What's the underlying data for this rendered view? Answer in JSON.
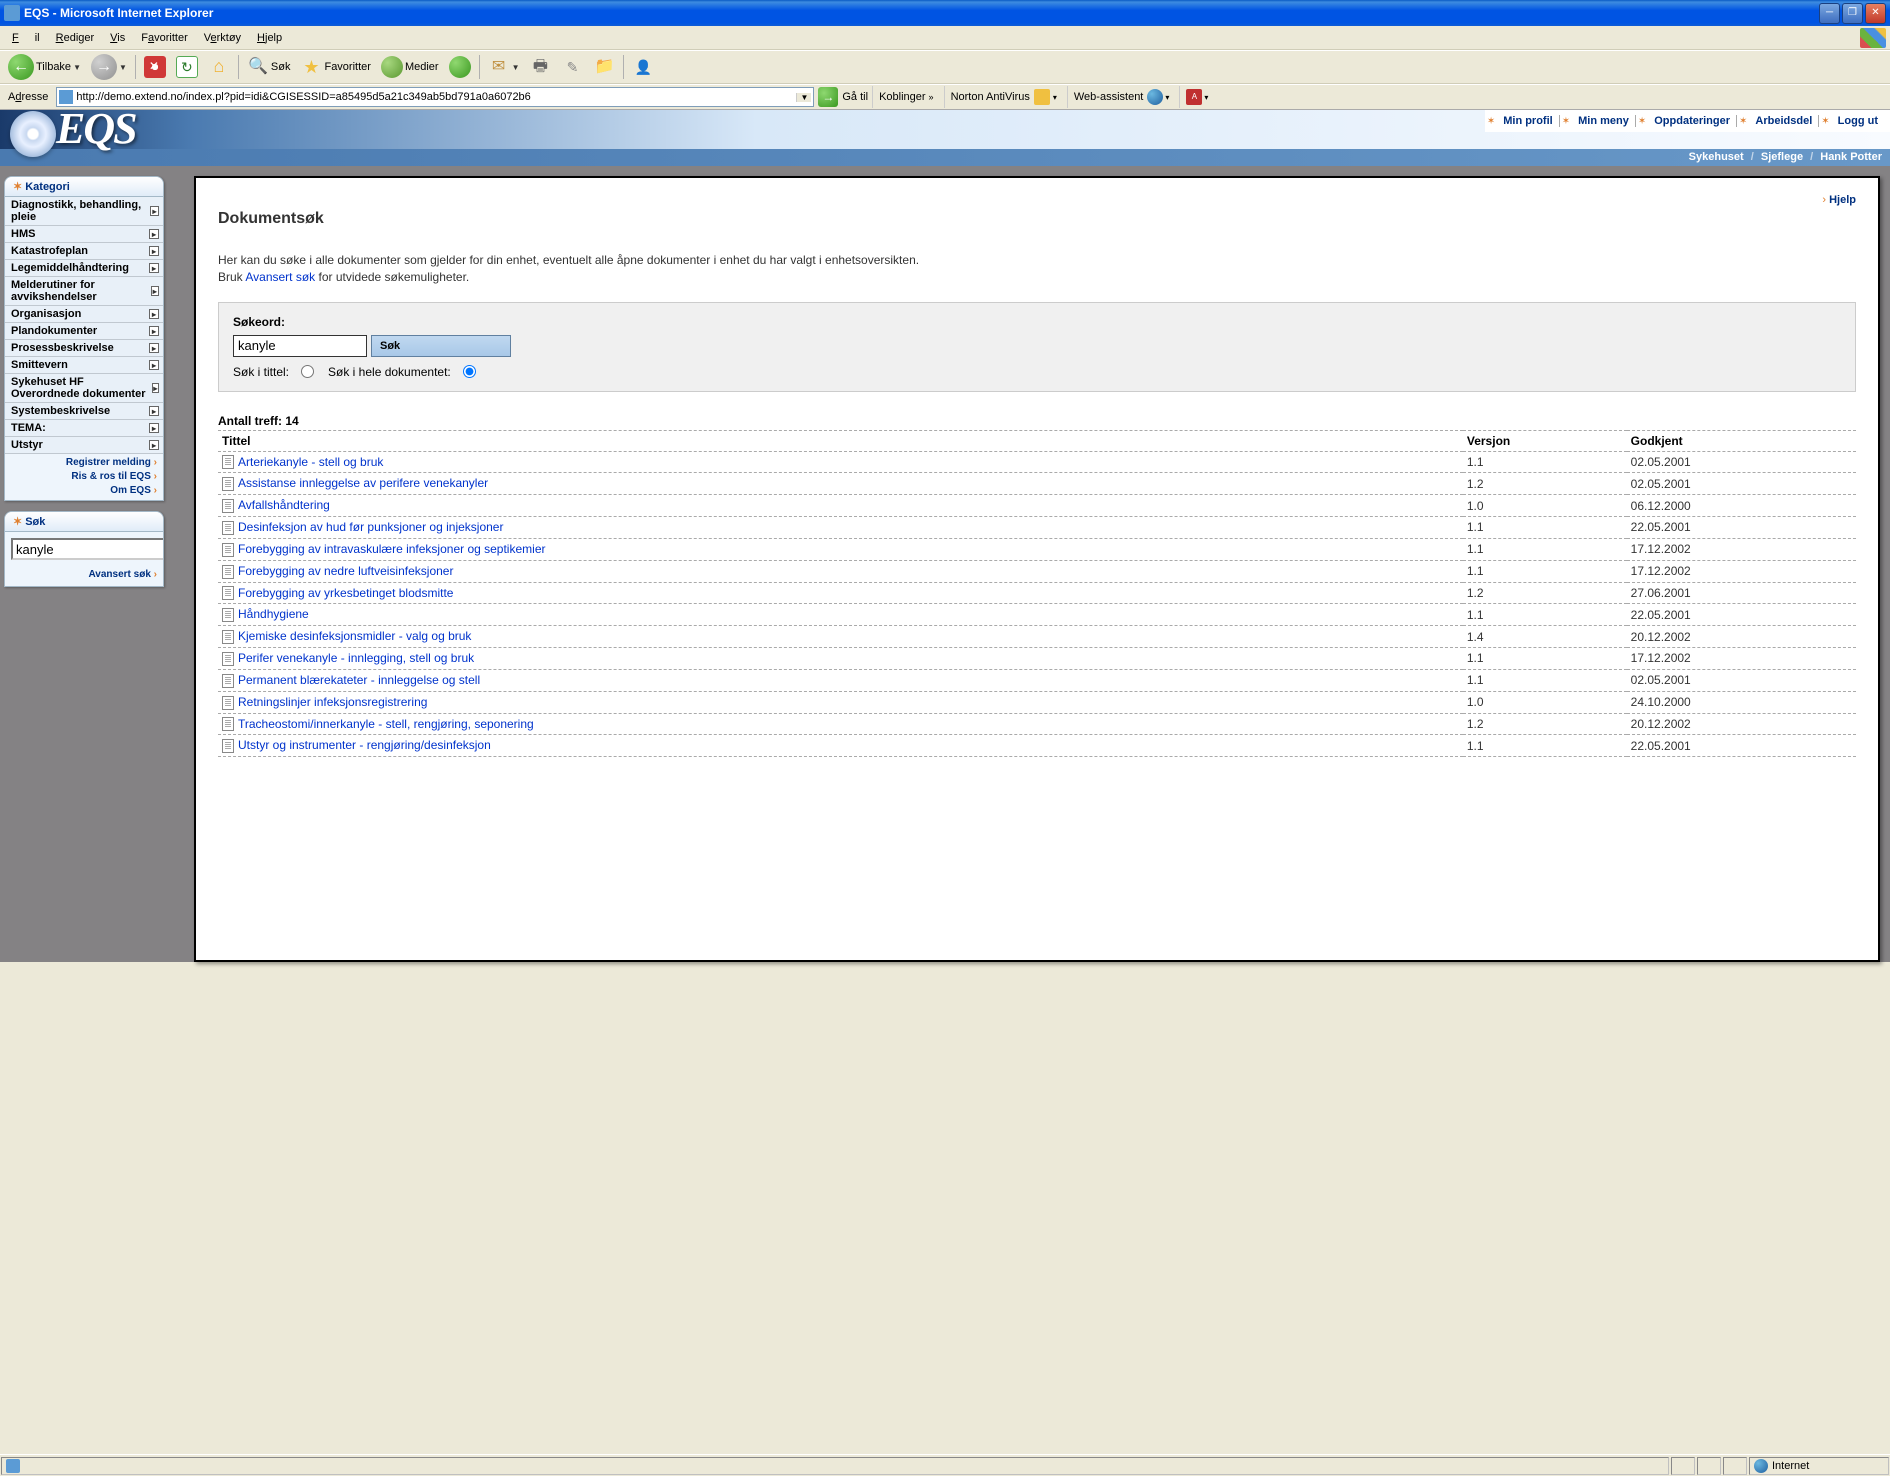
{
  "window": {
    "title": "EQS - Microsoft Internet Explorer"
  },
  "menubar": {
    "file": "Fil",
    "edit": "Rediger",
    "view": "Vis",
    "favorites": "Favoritter",
    "tools": "Verktøy",
    "help": "Hjelp"
  },
  "toolbar": {
    "back": "Tilbake",
    "search": "Søk",
    "favorites": "Favoritter",
    "media": "Medier"
  },
  "addressbar": {
    "label": "Adresse",
    "url": "http://demo.extend.no/index.pl?pid=idi&CGISESSID=a85495d5a21c349ab5bd791a0a6072b6",
    "go": "Gå til",
    "links": "Koblinger",
    "norton": "Norton AntiVirus",
    "webassist": "Web-assistent"
  },
  "topnav": {
    "profile": "Min profil",
    "menu": "Min meny",
    "updates": "Oppdateringer",
    "workspace": "Arbeidsdel",
    "logout": "Logg ut"
  },
  "subheader": {
    "org": "Sykehuset",
    "role": "Sjeflege",
    "user": "Hank Potter"
  },
  "sidebar": {
    "kategori_title": "Kategori",
    "categories": [
      "Diagnostikk, behandling, pleie",
      "HMS",
      "Katastrofeplan",
      "Legemiddelhåndtering",
      "Melderutiner for avvikshendelser",
      "Organisasjon",
      "Plandokumenter",
      "Prosessbeskrivelse",
      "Smittevern",
      "Sykehuset HF Overordnede dokumenter",
      "Systembeskrivelse",
      "TEMA:",
      "Utstyr"
    ],
    "links": {
      "register": "Registrer melding",
      "ros": "Ris & ros til EQS",
      "about": "Om EQS"
    },
    "sok_title": "Søk",
    "sok_value": "kanyle",
    "adv_search": "Avansert søk"
  },
  "main": {
    "help": "Hjelp",
    "title": "Dokumentsøk",
    "desc1": "Her kan du søke i alle dokumenter som gjelder for din enhet, eventuelt alle åpne dokumenter i enhet du har valgt i enhetsoversikten.",
    "desc2a": "Bruk ",
    "desc2link": "Avansert søk",
    "desc2b": " for utvidede søkemuligheter.",
    "search_label": "Søkeord:",
    "search_value": "kanyle",
    "search_button": "Søk",
    "radio_title": "Søk i tittel:",
    "radio_full": "Søk i hele dokumentet:",
    "result_count_label": "Antall treff: ",
    "result_count": "14",
    "col_title": "Tittel",
    "col_version": "Versjon",
    "col_approved": "Godkjent",
    "results": [
      {
        "title": "Arteriekanyle - stell og bruk",
        "version": "1.1",
        "approved": "02.05.2001"
      },
      {
        "title": "Assistanse innleggelse av perifere venekanyler",
        "version": "1.2",
        "approved": "02.05.2001"
      },
      {
        "title": "Avfallshåndtering",
        "version": "1.0",
        "approved": "06.12.2000"
      },
      {
        "title": "Desinfeksjon av hud før punksjoner og injeksjoner",
        "version": "1.1",
        "approved": "22.05.2001"
      },
      {
        "title": "Forebygging av intravaskulære infeksjoner og septikemier",
        "version": "1.1",
        "approved": "17.12.2002"
      },
      {
        "title": "Forebygging av nedre luftveisinfeksjoner",
        "version": "1.1",
        "approved": "17.12.2002"
      },
      {
        "title": "Forebygging av yrkesbetinget blodsmitte",
        "version": "1.2",
        "approved": "27.06.2001"
      },
      {
        "title": "Håndhygiene",
        "version": "1.1",
        "approved": "22.05.2001"
      },
      {
        "title": "Kjemiske desinfeksjonsmidler - valg og bruk",
        "version": "1.4",
        "approved": "20.12.2002"
      },
      {
        "title": "Perifer venekanyle - innlegging, stell og bruk",
        "version": "1.1",
        "approved": "17.12.2002"
      },
      {
        "title": "Permanent blærekateter - innleggelse og stell",
        "version": "1.1",
        "approved": "02.05.2001"
      },
      {
        "title": "Retningslinjer infeksjonsregistrering",
        "version": "1.0",
        "approved": "24.10.2000"
      },
      {
        "title": "Tracheostomi/innerkanyle - stell, rengjøring, seponering",
        "version": "1.2",
        "approved": "20.12.2002"
      },
      {
        "title": "Utstyr og instrumenter - rengjøring/desinfeksjon",
        "version": "1.1",
        "approved": "22.05.2001"
      }
    ]
  },
  "statusbar": {
    "zone": "Internet"
  }
}
